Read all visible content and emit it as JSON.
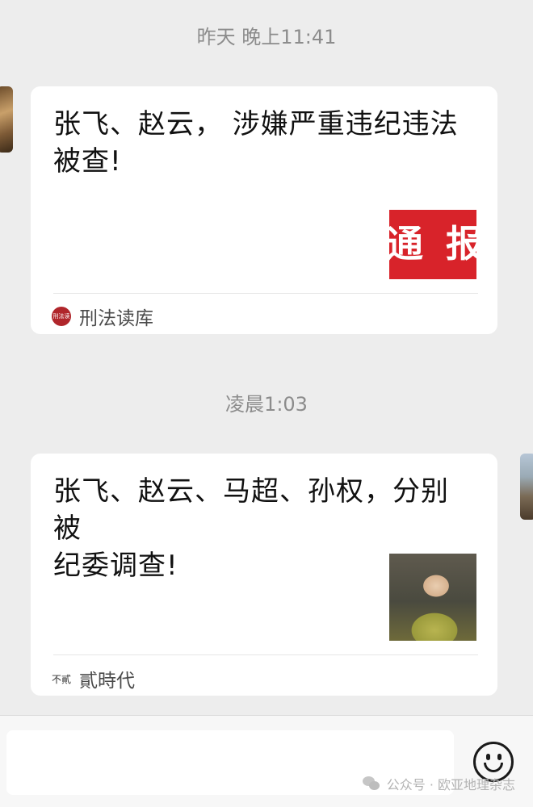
{
  "timestamps": [
    "昨天 晚上11:41",
    "凌晨1:03"
  ],
  "messages": [
    {
      "title_line1": "张飞、赵云， 涉嫌严重违纪违法",
      "title_line2": "被查!",
      "thumbnail_text": "通 报",
      "source_logo_text": "刑法读库",
      "source_name": "刑法读库"
    },
    {
      "title_line1": "张飞、赵云、马超、孙权，分别被",
      "title_line2": "纪委调查!",
      "source_logo_text": "不貳",
      "source_name": "貳時代"
    }
  ],
  "bottom": {
    "watermark": "公众号 · 欧亚地理杂志"
  },
  "colors": {
    "background": "#ededed",
    "card": "#ffffff",
    "thumbnail_red": "#d8232a"
  }
}
